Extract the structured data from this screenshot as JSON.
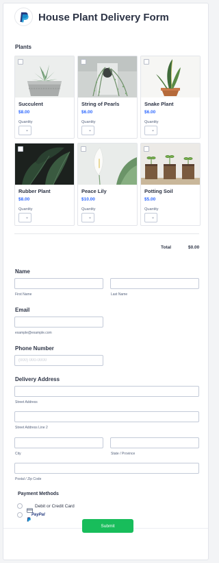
{
  "form": {
    "title": "House Plant Delivery Form",
    "plants_label": "Plants",
    "total_label": "Total",
    "total_value": "$0.00"
  },
  "products": [
    {
      "name": "Succulent",
      "price": "$8.00",
      "quantity_label": "Quantity"
    },
    {
      "name": "String of Pearls",
      "price": "$6.00",
      "quantity_label": "Quantity"
    },
    {
      "name": "Snake Plant",
      "price": "$6.00",
      "quantity_label": "Quantity"
    },
    {
      "name": "Rubber Plant",
      "price": "$8.00",
      "quantity_label": "Quantity"
    },
    {
      "name": "Peace Lily",
      "price": "$10.00",
      "quantity_label": "Quantity"
    },
    {
      "name": "Potting Soil",
      "price": "$5.00",
      "quantity_label": "Quantity"
    }
  ],
  "name": {
    "label": "Name",
    "first": "First Name",
    "last": "Last Name"
  },
  "email": {
    "label": "Email",
    "hint": "example@example.com"
  },
  "phone": {
    "label": "Phone Number",
    "placeholder": "(000) 000-0000"
  },
  "address": {
    "label": "Delivery Address",
    "street": "Street Address",
    "street2": "Street Address Line 2",
    "city": "City",
    "state": "State / Province",
    "zip": "Postal / Zip Code"
  },
  "payment": {
    "label": "Payment Methods",
    "card": "Debit or Credit Card",
    "paypal": "PayPal"
  },
  "submit_label": "Submit"
}
